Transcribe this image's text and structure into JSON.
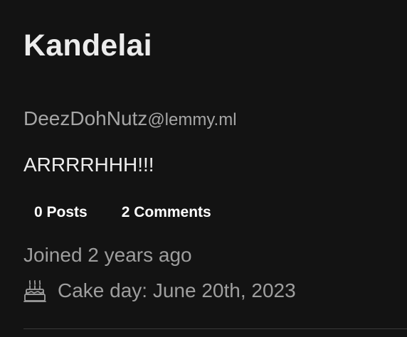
{
  "profile": {
    "display_name": "Kandelai",
    "username": "DeezDohNutz",
    "instance": "@lemmy.ml",
    "bio": "ARRRRHHH!!!",
    "stats": {
      "posts_label": "0 Posts",
      "comments_label": "2 Comments"
    },
    "joined": "Joined 2 years ago",
    "cake_day": "Cake day: June 20th, 2023",
    "cake_icon": "cake-icon"
  }
}
